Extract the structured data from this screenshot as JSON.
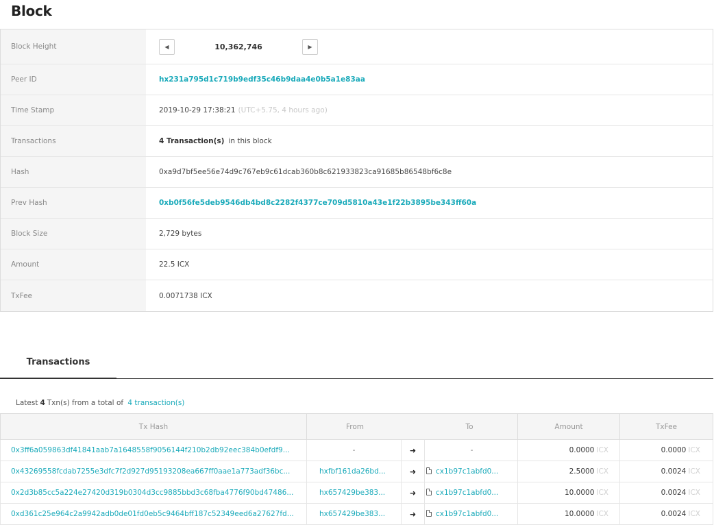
{
  "page": {
    "title": "Block"
  },
  "block": {
    "height_label": "Block Height",
    "height_value": "10,362,746",
    "prev_icon": "triangle-left",
    "next_icon": "triangle-right",
    "peer_label": "Peer ID",
    "peer_value": "hx231a795d1c719b9edf35c46b9daa4e0b5a1e83aa",
    "time_label": "Time Stamp",
    "time_value": "2019-10-29 17:38:21",
    "time_relative": "(UTC+5.75, 4 hours ago)",
    "tx_label": "Transactions",
    "tx_count_text": "4 Transaction(s)",
    "tx_suffix": "in this block",
    "hash_label": "Hash",
    "hash_value": "0xa9d7bf5ee56e74d9c767eb9c61dcab360b8c621933823ca91685b86548bf6c8e",
    "prev_hash_label": "Prev Hash",
    "prev_hash_value": "0xb0f56fe5deb9546db4bd8c2282f4377ce709d5810a43e1f22b3895be343ff60a",
    "size_label": "Block Size",
    "size_value": "2,729 bytes",
    "amount_label": "Amount",
    "amount_value": "22.5 ICX",
    "fee_label": "TxFee",
    "fee_value": "0.0071738 ICX"
  },
  "tabs": {
    "transactions": "Transactions"
  },
  "summary": {
    "prefix": "Latest",
    "count": "4",
    "middle": "Txn(s) from a total of",
    "link": "4 transaction(s)"
  },
  "tx_table": {
    "headers": {
      "hash": "Tx Hash",
      "from": "From",
      "to": "To",
      "amount": "Amount",
      "fee": "TxFee"
    },
    "unit": "ICX",
    "arrow_icon": "arrow-right",
    "contract_icon": "document",
    "rows": [
      {
        "hash": "0x3ff6a059863df41841aab7a1648558f9056144f210b2db92eec384b0efdf9...",
        "from": "-",
        "to": "-",
        "amount": "0.0000",
        "fee": "0.0000"
      },
      {
        "hash": "0x43269558fcdab7255e3dfc7f2d927d95193208ea667ff0aae1a773adf36bc...",
        "from": "hxfbf161da26bd...",
        "to": "cx1b97c1abfd0...",
        "amount": "2.5000",
        "fee": "0.0024"
      },
      {
        "hash": "0x2d3b85cc5a224e27420d319b0304d3cc9885bbd3c68fba4776f90bd47486...",
        "from": "hx657429be383...",
        "to": "cx1b97c1abfd0...",
        "amount": "10.0000",
        "fee": "0.0024"
      },
      {
        "hash": "0xd361c25e964c2a9942adb0de01fd0eb5c9464bff187c52349eed6a27627fd...",
        "from": "hx657429be383...",
        "to": "cx1b97c1abfd0...",
        "amount": "10.0000",
        "fee": "0.0024"
      }
    ]
  }
}
